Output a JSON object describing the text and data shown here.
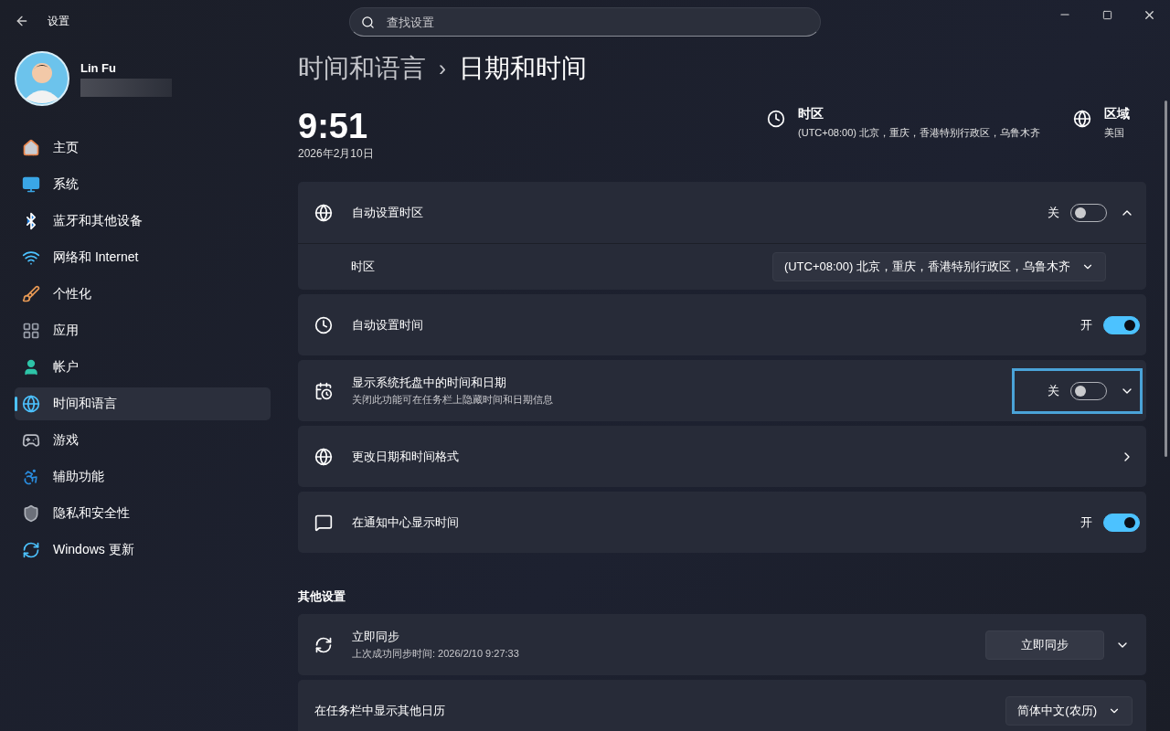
{
  "window": {
    "title": "设置"
  },
  "search": {
    "placeholder": "查找设置"
  },
  "user": {
    "name": "Lin Fu"
  },
  "sidebar": {
    "items": [
      {
        "label": "主页",
        "selected": false
      },
      {
        "label": "系统",
        "selected": false
      },
      {
        "label": "蓝牙和其他设备",
        "selected": false
      },
      {
        "label": "网络和 Internet",
        "selected": false
      },
      {
        "label": "个性化",
        "selected": false
      },
      {
        "label": "应用",
        "selected": false
      },
      {
        "label": "帐户",
        "selected": false
      },
      {
        "label": "时间和语言",
        "selected": true
      },
      {
        "label": "游戏",
        "selected": false
      },
      {
        "label": "辅助功能",
        "selected": false
      },
      {
        "label": "隐私和安全性",
        "selected": false
      },
      {
        "label": "Windows 更新",
        "selected": false
      }
    ]
  },
  "breadcrumb": {
    "parent": "时间和语言",
    "separator": "›",
    "current": "日期和时间"
  },
  "clock": {
    "time": "9:51",
    "date": "2026年2月10日"
  },
  "summary": [
    {
      "label": "时区",
      "value": "(UTC+08:00) 北京，重庆，香港特别行政区，乌鲁木齐"
    },
    {
      "label": "区域",
      "value": "美国"
    }
  ],
  "rows": [
    {
      "kind": "toggle",
      "title": "自动设置时区",
      "state_label": "关",
      "on": false,
      "expanded": true,
      "focused": false,
      "children": [
        {
          "label": "时区",
          "value": "(UTC+08:00) 北京，重庆，香港特别行政区，乌鲁木齐"
        }
      ]
    },
    {
      "kind": "toggle",
      "title": "自动设置时间",
      "state_label": "开",
      "on": true
    },
    {
      "kind": "toggle",
      "title": "显示系统托盘中的时间和日期",
      "subtitle": "关闭此功能可在任务栏上隐藏时间和日期信息",
      "state_label": "关",
      "on": false,
      "expanded": false,
      "focused": true
    },
    {
      "kind": "link",
      "title": "更改日期和时间格式"
    },
    {
      "kind": "toggle",
      "title": "在通知中心显示时间",
      "state_label": "开",
      "on": true
    }
  ],
  "other": {
    "heading": "其他设置",
    "rows": [
      {
        "kind": "button",
        "title": "立即同步",
        "subtitle": "上次成功同步时间: 2026/2/10 9:27:33",
        "button": "立即同步",
        "expanded": false
      },
      {
        "kind": "dropdown",
        "title": "在任务栏中显示其他日历",
        "value": "简体中文(农历)"
      }
    ]
  }
}
